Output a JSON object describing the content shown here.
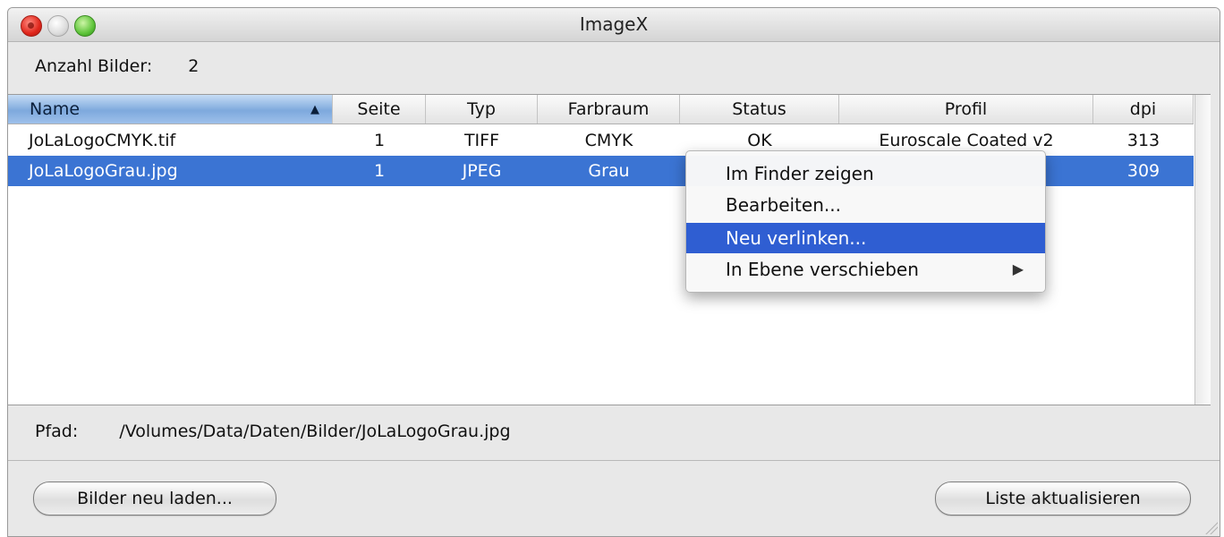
{
  "window": {
    "title": "ImageX"
  },
  "summary": {
    "count_label": "Anzahl Bilder:",
    "count_value": "2"
  },
  "table": {
    "columns": [
      "Name",
      "Seite",
      "Typ",
      "Farbraum",
      "Status",
      "Profil",
      "dpi"
    ],
    "sorted_column": "Name",
    "sort_direction": "ascending",
    "rows": [
      {
        "name": "JoLaLogoCMYK.tif",
        "seite": "1",
        "typ": "TIFF",
        "farbraum": "CMYK",
        "status": "OK",
        "profil": "Euroscale Coated v2",
        "dpi": "313",
        "selected": false
      },
      {
        "name": "JoLaLogoGrau.jpg",
        "seite": "1",
        "typ": "JPEG",
        "farbraum": "Grau",
        "status": "",
        "profil": "",
        "dpi": "309",
        "selected": true
      }
    ]
  },
  "path": {
    "label": "Pfad:",
    "value": "/Volumes/Data/Daten/Bilder/JoLaLogoGrau.jpg"
  },
  "buttons": {
    "reload": "Bilder neu laden...",
    "update": "Liste aktualisieren"
  },
  "context_menu": {
    "items": [
      {
        "label": "Im Finder zeigen",
        "highlighted": false,
        "has_submenu": false
      },
      {
        "label": "Bearbeiten...",
        "highlighted": false,
        "has_submenu": false
      },
      {
        "label": "Neu verlinken...",
        "highlighted": true,
        "has_submenu": false
      },
      {
        "label": "In Ebene verschieben",
        "highlighted": false,
        "has_submenu": true
      }
    ]
  },
  "colors": {
    "selection": "#3b74d3",
    "menu_highlight": "#2f5ed2",
    "header_sorted": "#7ea9dd"
  }
}
